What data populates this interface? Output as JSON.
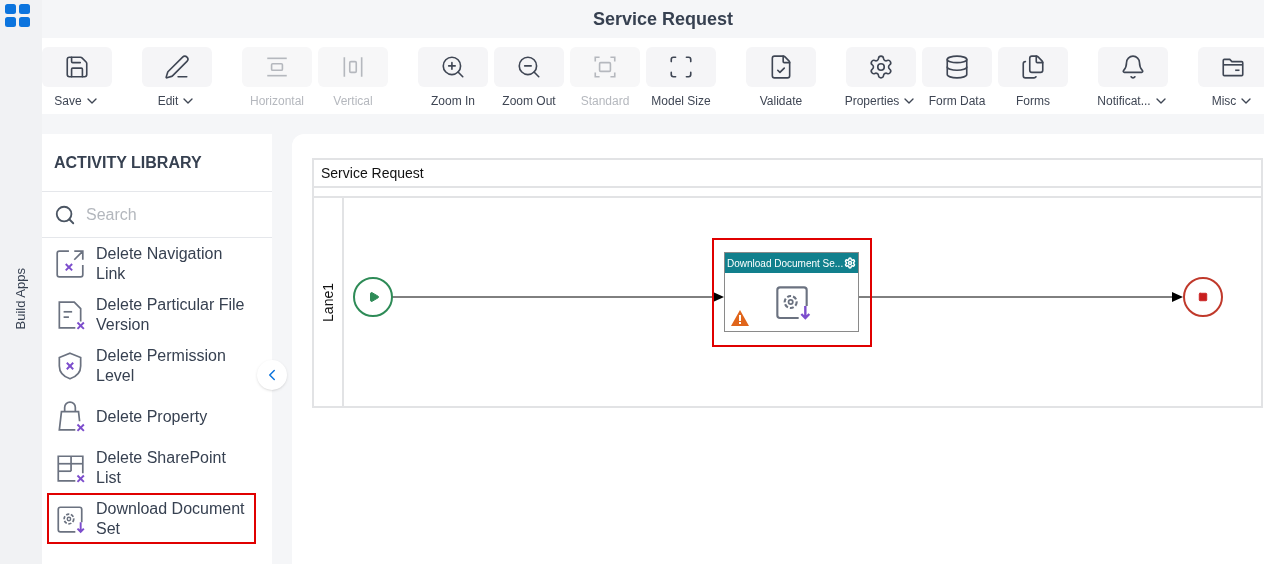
{
  "app_rail": {
    "label": "Build Apps"
  },
  "header": {
    "title": "Service Request"
  },
  "toolbar": {
    "groups": [
      {
        "items": [
          {
            "label": "Save",
            "disabled": false,
            "dropdown": true
          }
        ]
      },
      {
        "items": [
          {
            "label": "Edit",
            "disabled": false,
            "dropdown": true
          }
        ]
      },
      {
        "items": [
          {
            "label": "Horizontal",
            "disabled": true,
            "dropdown": false
          },
          {
            "label": "Vertical",
            "disabled": true,
            "dropdown": false
          }
        ]
      },
      {
        "items": [
          {
            "label": "Zoom In",
            "disabled": false,
            "dropdown": false
          },
          {
            "label": "Zoom Out",
            "disabled": false,
            "dropdown": false
          },
          {
            "label": "Standard",
            "disabled": true,
            "dropdown": false
          },
          {
            "label": "Model Size",
            "disabled": false,
            "dropdown": false
          }
        ]
      },
      {
        "items": [
          {
            "label": "Validate",
            "disabled": false,
            "dropdown": false
          }
        ]
      },
      {
        "items": [
          {
            "label": "Properties",
            "disabled": false,
            "dropdown": true
          },
          {
            "label": "Form Data",
            "disabled": false,
            "dropdown": false
          },
          {
            "label": "Forms",
            "disabled": false,
            "dropdown": false
          }
        ]
      },
      {
        "items": [
          {
            "label": "Notificat...",
            "disabled": false,
            "dropdown": true
          }
        ]
      },
      {
        "items": [
          {
            "label": "Misc",
            "disabled": false,
            "dropdown": true
          }
        ]
      }
    ]
  },
  "activity_library": {
    "title": "ACTIVITY LIBRARY",
    "search": {
      "placeholder": "Search"
    },
    "items": [
      {
        "label": "Delete Navigation Link",
        "selected": false
      },
      {
        "label": "Delete Particular File Version",
        "selected": false
      },
      {
        "label": "Delete Permission Level",
        "selected": false
      },
      {
        "label": "Delete Property",
        "selected": false
      },
      {
        "label": "Delete SharePoint List",
        "selected": false
      },
      {
        "label": "Download Document Set",
        "selected": true
      }
    ]
  },
  "canvas": {
    "pool": {
      "title": "Service Request",
      "lanes": [
        {
          "label": "Lane1"
        }
      ]
    },
    "node": {
      "title": "Download Document Se...",
      "warning": true,
      "selected": true
    }
  }
}
